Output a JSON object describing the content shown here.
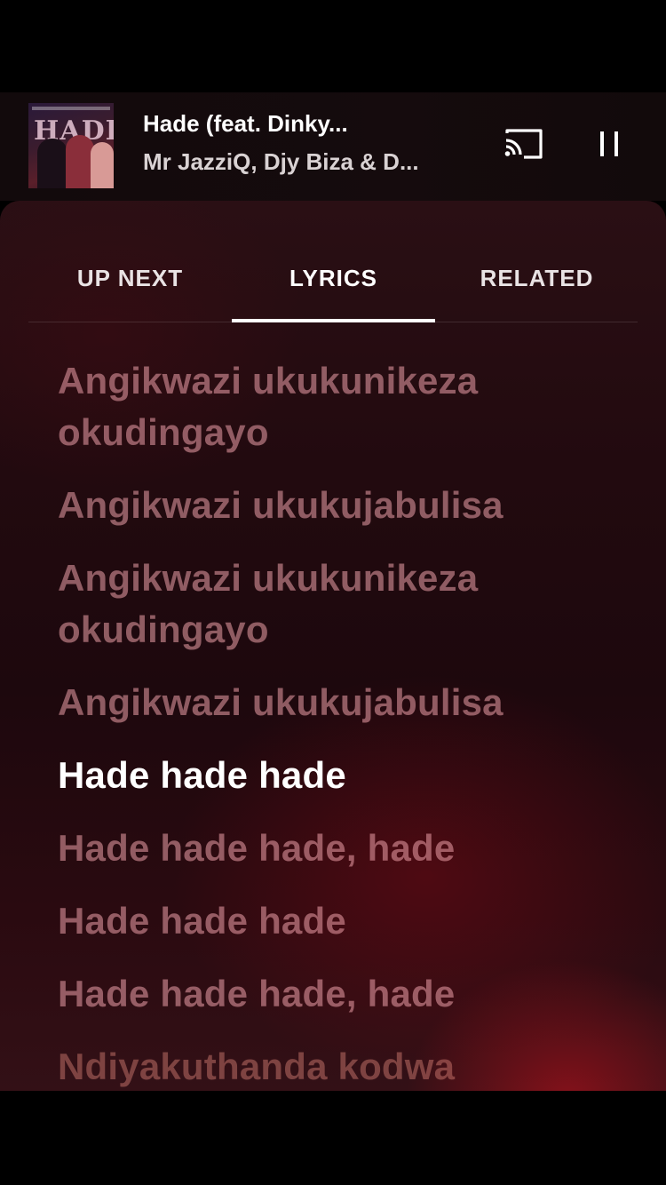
{
  "now_playing": {
    "title": "Hade (feat. Dinky...",
    "artist": "Mr JazziQ, Djy Biza & D...",
    "album_art_text": "HADE"
  },
  "controls": {
    "cast_icon": "cast-icon",
    "pause_icon": "pause-icon"
  },
  "tabs": [
    {
      "label": "UP NEXT",
      "active": false
    },
    {
      "label": "LYRICS",
      "active": true
    },
    {
      "label": "RELATED",
      "active": false
    }
  ],
  "lyrics": [
    {
      "text": "Angikwazi ukukunikeza okudingayo",
      "state": "past"
    },
    {
      "text": "Angikwazi ukukujabulisa",
      "state": "past"
    },
    {
      "text": "Angikwazi ukukunikeza okudingayo",
      "state": "past"
    },
    {
      "text": "Angikwazi ukukujabulisa",
      "state": "past"
    },
    {
      "text": "Hade hade hade",
      "state": "current"
    },
    {
      "text": "Hade hade hade, hade",
      "state": "upcoming"
    },
    {
      "text": "Hade hade hade",
      "state": "upcoming"
    },
    {
      "text": "Hade hade hade, hade",
      "state": "upcoming"
    },
    {
      "text": "Ndiyakuthanda kodwa",
      "state": "upcoming"
    }
  ],
  "colors": {
    "accent": "#ffffff",
    "panel_background": "#220a0f",
    "inactive_lyric": "#eca0aa"
  }
}
